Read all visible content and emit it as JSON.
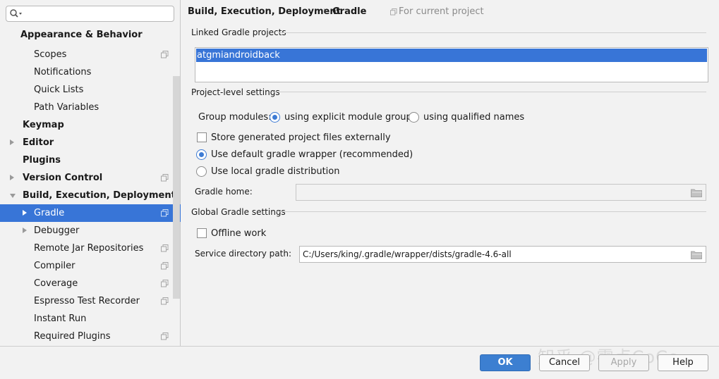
{
  "search": {
    "value": "",
    "placeholder": ""
  },
  "sidebar": {
    "items": [
      {
        "label": "Appearance & Behavior",
        "bold": true
      },
      {
        "label": "Scopes"
      },
      {
        "label": "Notifications"
      },
      {
        "label": "Quick Lists"
      },
      {
        "label": "Path Variables"
      },
      {
        "label": "Keymap",
        "bold": true
      },
      {
        "label": "Editor",
        "bold": true
      },
      {
        "label": "Plugins",
        "bold": true
      },
      {
        "label": "Version Control",
        "bold": true
      },
      {
        "label": "Build, Execution, Deployment",
        "bold": true
      },
      {
        "label": "Gradle",
        "selected": true
      },
      {
        "label": "Debugger"
      },
      {
        "label": "Remote Jar Repositories"
      },
      {
        "label": "Compiler"
      },
      {
        "label": "Coverage"
      },
      {
        "label": "Espresso Test Recorder"
      },
      {
        "label": "Instant Run"
      },
      {
        "label": "Required Plugins"
      }
    ]
  },
  "breadcrumb": {
    "parent": "Build, Execution, Deployment",
    "separator": "›",
    "current": "Gradle",
    "scope_note": "For current project"
  },
  "linked_projects": {
    "title": "Linked Gradle projects",
    "items": [
      "atgmiandroidback"
    ]
  },
  "project_settings": {
    "title": "Project-level settings",
    "group_modules_label": "Group modules:",
    "group_option_explicit": "using explicit module groups",
    "group_option_qualified": "using qualified names",
    "store_generated": "Store generated project files externally",
    "use_default_wrapper": "Use default gradle wrapper (recommended)",
    "use_local_distribution": "Use local gradle distribution",
    "gradle_home_label": "Gradle home:",
    "gradle_home_value": ""
  },
  "global_settings": {
    "title": "Global Gradle settings",
    "offline_work": "Offline work",
    "service_dir_label": "Service directory path:",
    "service_dir_value": "C:/Users/king/.gradle/wrapper/dists/gradle-4.6-all"
  },
  "buttons": {
    "ok": "OK",
    "cancel": "Cancel",
    "apply": "Apply",
    "help": "Help"
  },
  "watermark": "知乎 @零点CoCo",
  "colors": {
    "selection": "#3875d7",
    "primary_button": "#3c7fd1"
  }
}
